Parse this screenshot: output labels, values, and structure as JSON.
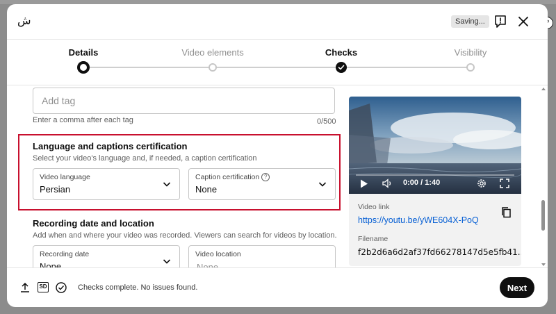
{
  "channel": {
    "name": "ش"
  },
  "header": {
    "saving_badge": "Saving..."
  },
  "colors": {
    "accent_link": "#065fd4",
    "highlight_border": "#c8102e",
    "primary_button": "#0f0f0f"
  },
  "stepper": {
    "steps": [
      {
        "label": "Details",
        "state": "current"
      },
      {
        "label": "Video elements",
        "state": "pending"
      },
      {
        "label": "Checks",
        "state": "done"
      },
      {
        "label": "Visibility",
        "state": "pending"
      }
    ]
  },
  "tags": {
    "placeholder": "Add tag",
    "hint": "Enter a comma after each tag",
    "counter": "0/500"
  },
  "language_certification": {
    "title": "Language and captions certification",
    "description": "Select your video's language and, if needed, a caption certification",
    "video_language": {
      "label": "Video language",
      "value": "Persian"
    },
    "caption_certification": {
      "label": "Caption certification",
      "value": "None",
      "info_glyph": "?"
    }
  },
  "recording": {
    "title": "Recording date and location",
    "description": "Add when and where your video was recorded. Viewers can search for videos by location.",
    "recording_date": {
      "label": "Recording date",
      "value": "None"
    },
    "video_location": {
      "label": "Video location",
      "placeholder": "None"
    }
  },
  "video": {
    "time": "0:00 / 1:40",
    "link_label": "Video link",
    "link": "https://youtu.be/yWE604X-PoQ",
    "filename_label": "Filename",
    "filename": "f2b2d6a6d2af37fd66278147d5e5fb41..."
  },
  "footer": {
    "status": "Checks complete. No issues found.",
    "next_label": "Next",
    "sd_badge": "SD"
  },
  "icons": [
    "report-flag-icon",
    "close-icon",
    "help-icon",
    "chevron-down-icon",
    "play-icon",
    "volume-icon",
    "settings-icon",
    "fullscreen-icon",
    "copy-icon",
    "upload-icon",
    "sd-icon",
    "check-circle-icon"
  ]
}
